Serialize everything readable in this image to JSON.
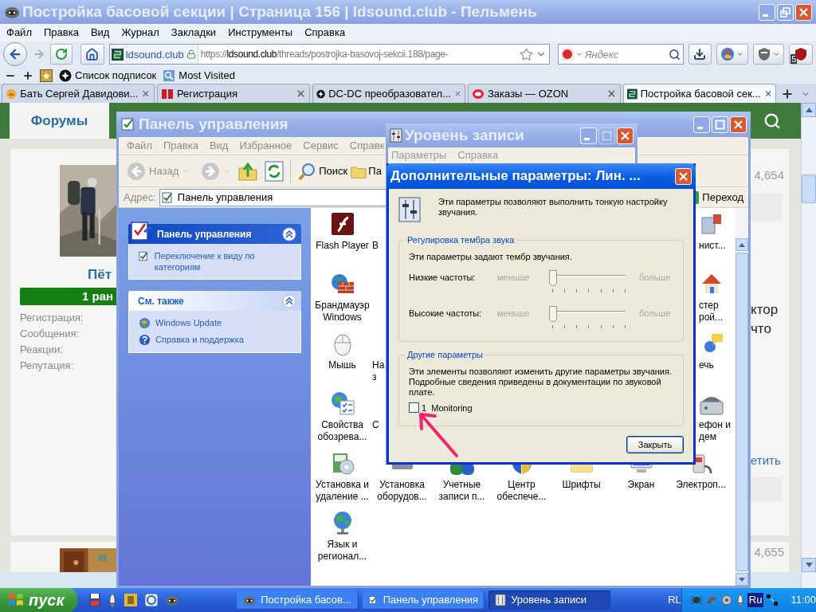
{
  "browser": {
    "title": "Постройка басовой секции | Страница 156 | ldsound.club - Пельмень",
    "active": false,
    "menu": [
      "Файл",
      "Правка",
      "Вид",
      "Журнал",
      "Закладки",
      "Инструменты",
      "Справка"
    ],
    "forward": {
      "disabled": true
    },
    "site": "ldsound.club",
    "url": {
      "scheme": "https://",
      "host": "ldsound.club",
      "path": "/threads/postrojka-basovoj-sekcii.188/page-"
    },
    "search": {
      "placeholder": "Яндекс"
    },
    "addon_badge": "5",
    "bookmarks": [
      "Список подписок",
      "Most Visited"
    ],
    "tabs": [
      {
        "label": "Бать Сергей Давидови...",
        "selected": false
      },
      {
        "label": "Регистрация",
        "selected": false
      },
      {
        "label": "DC-DC преобразовател...",
        "selected": false
      },
      {
        "label": "Заказы — OZON",
        "selected": false
      },
      {
        "label": "Постройка басовой сек...",
        "selected": true
      }
    ],
    "page": {
      "nav_tab": "Форумы",
      "author": {
        "name": "Пёт",
        "rank": "1 ран",
        "stats": [
          "Регистрация:",
          "Сообщения:",
          "Реакции:",
          "Репутация:"
        ]
      },
      "side": {
        "post_number": "4,654",
        "text_lines": [
          "ктор",
          "что"
        ],
        "link": "етить",
        "next_post_number": "4,655"
      }
    }
  },
  "control_panel": {
    "title": "Панель управления",
    "active": false,
    "menu": [
      "Файл",
      "Правка",
      "Вид",
      "Избранное",
      "Сервис",
      "Справк"
    ],
    "back": {
      "label": "Назад",
      "disabled": true
    },
    "forward": {
      "disabled": true
    },
    "search_button": "Поиск",
    "folders_button": "Па",
    "address": {
      "label": "Адрес:",
      "value": "Панель управления",
      "go": "Переход"
    },
    "task_panes": [
      {
        "title": "Панель управления",
        "expanded": true,
        "links": [
          "Переключение к виду по категориям"
        ]
      },
      {
        "title": "См. также",
        "expanded": true,
        "links": [
          "Windows Update",
          "Справка и поддержка"
        ]
      }
    ],
    "icon_rows": [
      {
        "items": [
          "Flash Player"
        ],
        "cut_left": "В",
        "cut_right": "нист..."
      },
      {
        "items": [
          "Брандмауэр\nWindows"
        ],
        "cut_right": "стер\nрой..."
      },
      {
        "items": [
          "Мышь"
        ],
        "cut_left": "На\nз",
        "cut_right": "ечь"
      },
      {
        "items": [
          "Свойства\nобозрева..."
        ],
        "cut_left": "С",
        "cut_right": "ефон и\nдем"
      },
      {
        "items": [
          "Установка и\nудаление ...",
          "Установка\nоборудов...",
          "Учетные\nзаписи п...",
          "Центр\nобеспече...",
          "Шрифты",
          "Экран",
          "Электроп..."
        ]
      },
      {
        "items": [
          "Язык и\nрегионал..."
        ]
      }
    ]
  },
  "recording_window": {
    "title": "Уровень записи",
    "active": false,
    "maximize_disabled": true,
    "menu": [
      "Параметры",
      "Справка"
    ]
  },
  "dialog": {
    "title": "Дополнительные параметры: Лин. ...",
    "active": true,
    "intro": "Эти параметры позволяют выполнить тонкую настройку звучания.",
    "tone": {
      "legend": "Регулировка тембра звука",
      "note": "Эти параметры задают тембр звучания.",
      "sliders": [
        {
          "label": "Низкие частоты:",
          "min_label": "меньше",
          "max_label": "больше",
          "level": 0
        },
        {
          "label": "Высокие частоты:",
          "min_label": "меньше",
          "max_label": "больше",
          "level": 0
        }
      ]
    },
    "other": {
      "legend": "Другие параметры",
      "note": "Эти элементы позволяют изменить другие параметры звучания. Подробные сведения приведены в документации по звуковой плате.",
      "options": [
        {
          "label": "1  Monitoring",
          "checked": false
        }
      ]
    },
    "close_button": "Закрыть"
  },
  "taskbar": {
    "start": "пуск",
    "tasks": [
      {
        "label": "Постройка басов...",
        "selected": false
      },
      {
        "label": "Панель управления",
        "selected": false
      },
      {
        "label": "Уровень записи",
        "selected": true
      }
    ],
    "language": "RL",
    "tray_badge": "Ru",
    "clock": "11:00"
  }
}
